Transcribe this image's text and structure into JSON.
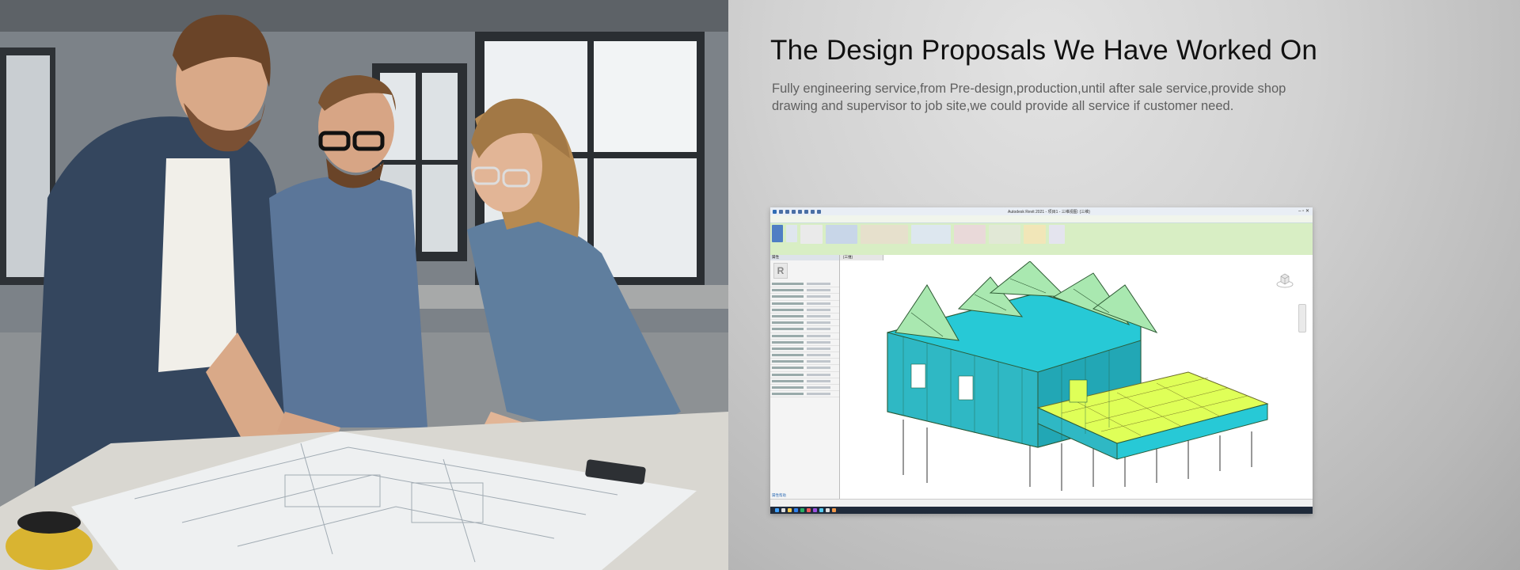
{
  "section": {
    "title": "The Design Proposals We Have Worked On",
    "description": "Fully engineering service,from Pre-design,production,until after sale service,provide shop drawing and supervisor to job site,we could provide all service if customer need."
  },
  "screenshot": {
    "app_title": "Autodesk Revit 2021 - 项目1 - 三维视图: {三维}",
    "properties_header": "属性",
    "properties_link": "属性帮助",
    "view_tab": "{三维}",
    "colors": {
      "ribbon": "#d8eec4",
      "model_cyan": "#27c9d6",
      "model_green": "#a9e8b0",
      "model_yellow": "#dfff58",
      "taskbar": "#1f2a3a"
    }
  },
  "photo": {
    "subject": "three colleagues reviewing architectural blueprints at a table"
  }
}
